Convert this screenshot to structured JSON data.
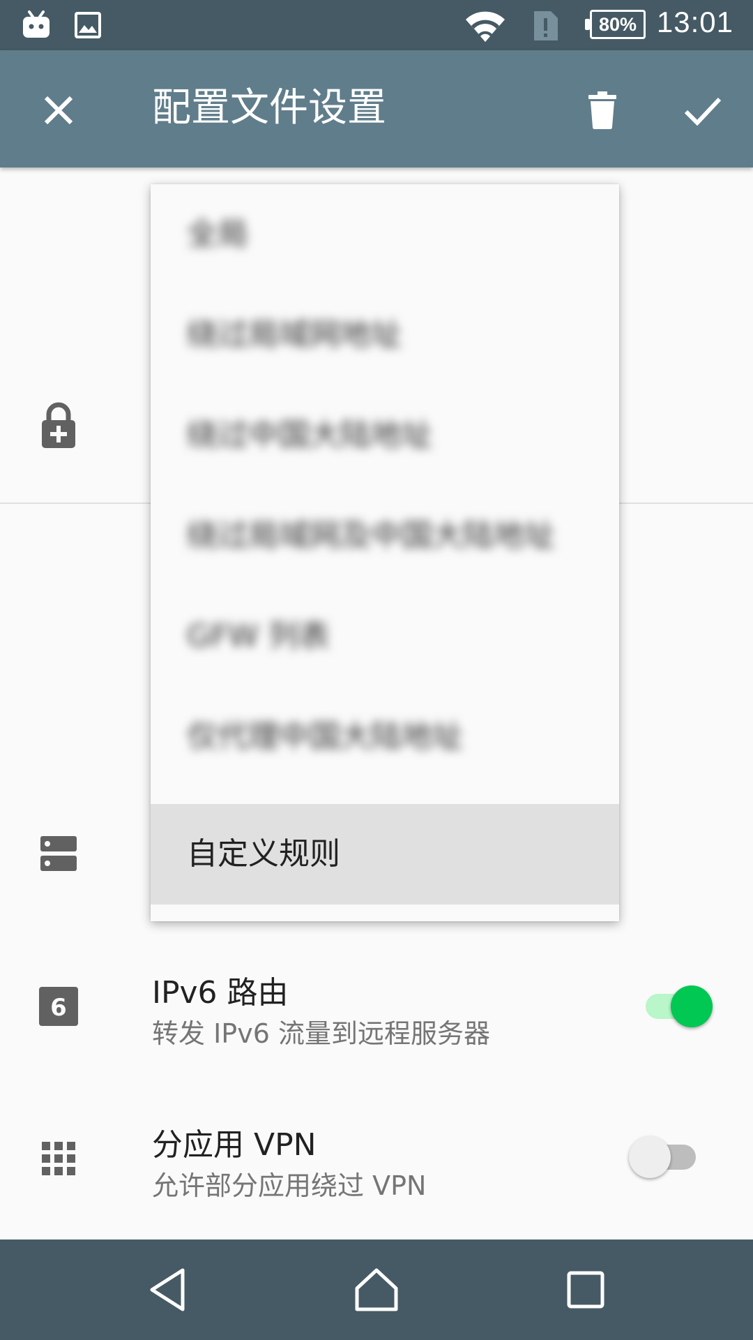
{
  "status_bar": {
    "time": "13:01",
    "battery": "80%",
    "icons": [
      "bilibili-icon",
      "image-icon",
      "wifi-icon",
      "sim-alert-icon",
      "battery-icon"
    ]
  },
  "toolbar": {
    "title": "配置文件设置",
    "icons": [
      "close-icon",
      "delete-icon",
      "check-icon"
    ]
  },
  "dropdown": {
    "options": [
      "全局",
      "绕过局域网地址",
      "绕过中国大陆地址",
      "绕过局域网及中国大陆地址",
      "GFW 列表",
      "仅代理中国大陆地址",
      "自定义规则"
    ],
    "selected": "自定义规则"
  },
  "settings": {
    "ipv6": {
      "title": "IPv6 路由",
      "subtitle": "转发 IPv6 流量到远程服务器",
      "enabled": true
    },
    "per_app": {
      "title": "分应用 VPN",
      "subtitle": "允许部分应用绕过 VPN",
      "enabled": false
    }
  },
  "colors": {
    "status_bar": "#455a64",
    "toolbar": "#607d8b",
    "accent": "#00c853",
    "accent_track": "#b9f6ca"
  },
  "nav_bar": {
    "icons": [
      "back-icon",
      "home-icon",
      "recents-icon"
    ]
  }
}
